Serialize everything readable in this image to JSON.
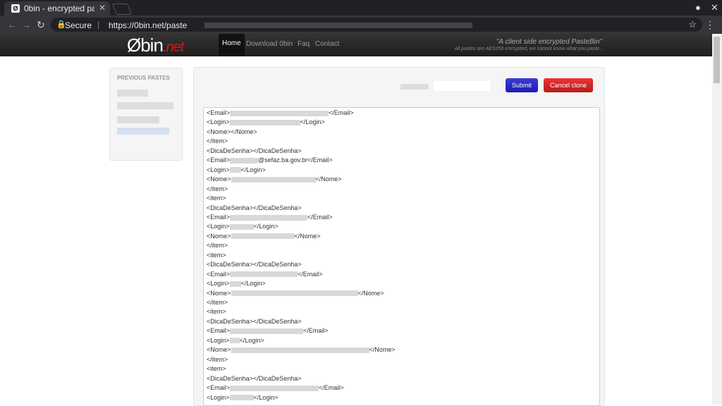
{
  "browser": {
    "tab_title": "0bin - encrypted pas",
    "secure_label": "Secure",
    "url": "https://0bin.net/paste"
  },
  "site": {
    "logo_main": "Øbin",
    "logo_net": ".net",
    "nav": [
      "Home",
      "Download 0bin",
      "Faq",
      "Contact"
    ],
    "slogan": "\"A client side encrypted PasteBin\"",
    "sub_slogan": "All pastes are AES256 encrypted, we cannot know what you paste..."
  },
  "sidebar": {
    "heading": "PREVIOUS PASTES"
  },
  "form": {
    "submit_label": "Submit",
    "cancel_label": "Cancel clone"
  },
  "paste_lines": [
    {
      "pre": "<Email>",
      "post": "</Email>",
      "blur": 140
    },
    {
      "pre": "<Login>",
      "post": "</Login>",
      "blur": 100
    },
    {
      "pre": "<Nome></Nome>",
      "post": "",
      "blur": 0
    },
    {
      "pre": "</item>",
      "post": "",
      "blur": 0
    },
    {
      "pre": "<DicaDeSenha></DicaDeSenha>",
      "post": "",
      "blur": 0
    },
    {
      "pre": "<Email>",
      "post": "@sefaz.ba.gov.br</Email>",
      "blur": 40
    },
    {
      "pre": "<Login>",
      "post": "</Login>",
      "blur": 16
    },
    {
      "pre": "<Nome>",
      "post": "</Nome>",
      "blur": 120
    },
    {
      "pre": "</item>",
      "post": "",
      "blur": 0
    },
    {
      "pre": "<item>",
      "post": "",
      "blur": 0
    },
    {
      "pre": "<DicaDeSenha></DicaDeSenha>",
      "post": "",
      "blur": 0
    },
    {
      "pre": "<Email>",
      "post": "</Email>",
      "blur": 110
    },
    {
      "pre": "<Login>",
      "post": "</Login>",
      "blur": 34
    },
    {
      "pre": "<Nome>",
      "post": "</Nome>",
      "blur": 90
    },
    {
      "pre": "</item>",
      "post": "",
      "blur": 0
    },
    {
      "pre": "<item>",
      "post": "",
      "blur": 0
    },
    {
      "pre": "<DicaDeSenha></DicaDeSenha>",
      "post": "",
      "blur": 0
    },
    {
      "pre": "<Email>",
      "post": "</Email>",
      "blur": 96
    },
    {
      "pre": "<Login>",
      "post": "</Login>",
      "blur": 16
    },
    {
      "pre": "<Nome>",
      "post": "</Nome>",
      "blur": 180
    },
    {
      "pre": "</item>",
      "post": "",
      "blur": 0
    },
    {
      "pre": "<item>",
      "post": "",
      "blur": 0
    },
    {
      "pre": "<DicaDeSenha></DicaDeSenha>",
      "post": "",
      "blur": 0
    },
    {
      "pre": "<Email>",
      "post": "</Email>",
      "blur": 104
    },
    {
      "pre": "<Login>",
      "post": "</Login>",
      "blur": 14
    },
    {
      "pre": "<Nome>",
      "post": "</Nome>",
      "blur": 196
    },
    {
      "pre": "</item>",
      "post": "",
      "blur": 0
    },
    {
      "pre": "<item>",
      "post": "",
      "blur": 0
    },
    {
      "pre": "<DicaDeSenha></DicaDeSenha>",
      "post": "",
      "blur": 0
    },
    {
      "pre": "<Email>",
      "post": "</Email>",
      "blur": 126
    },
    {
      "pre": "<Login>",
      "post": "</Login>",
      "blur": 34
    }
  ]
}
